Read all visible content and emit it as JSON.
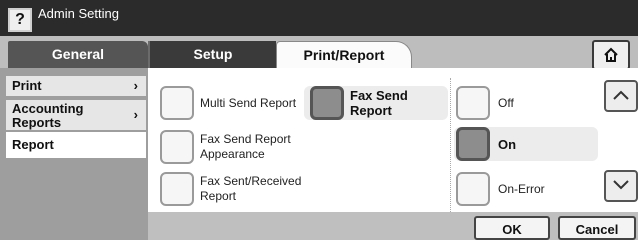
{
  "titlebar": {
    "help_label": "?",
    "title": "Admin Setting"
  },
  "tabs": [
    {
      "label": "General"
    },
    {
      "label": "Setup"
    },
    {
      "label": "Print/Report"
    }
  ],
  "home_icon": "home-icon",
  "nav": [
    {
      "label": "Print",
      "chevron": "›"
    },
    {
      "label": "Accounting Reports",
      "chevron": "›"
    },
    {
      "label": "Report"
    }
  ],
  "report_types": [
    {
      "label": "Multi Send Report",
      "selected": false
    },
    {
      "label": "Fax Send Report Appearance",
      "selected": false
    },
    {
      "label": "Fax Sent/Received Report",
      "selected": false
    }
  ],
  "fax_send_report": {
    "label": "Fax Send Report",
    "selected": true
  },
  "fax_send_options": [
    {
      "label": "Off",
      "selected": false
    },
    {
      "label": "On",
      "selected": true
    },
    {
      "label": "On-Error",
      "selected": false
    }
  ],
  "actions": {
    "ok": "OK",
    "cancel": "Cancel"
  },
  "colors": {
    "title_bg": "#2b2b2b",
    "panel_bg": "#9e9e9e",
    "selected_btn": "#8d8d8d"
  }
}
